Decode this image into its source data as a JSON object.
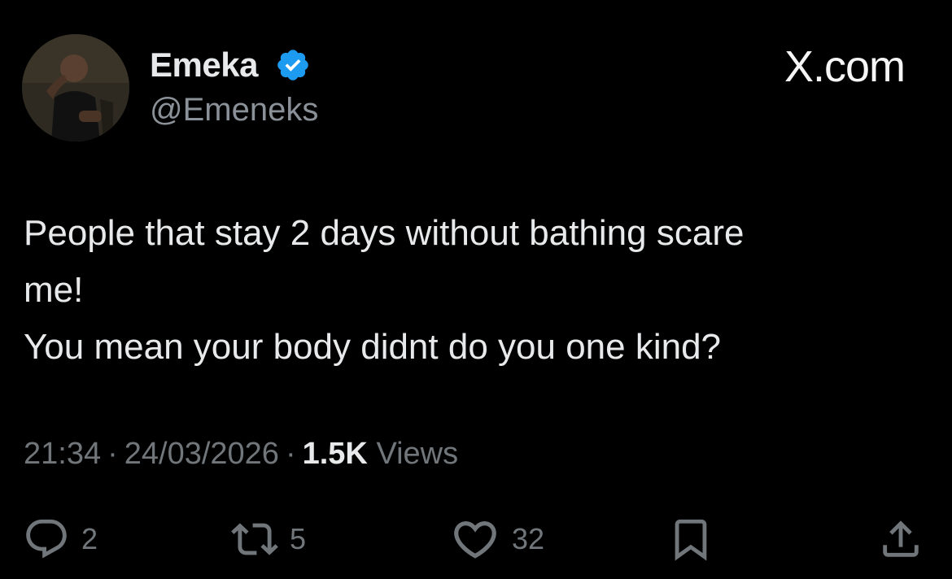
{
  "author": {
    "display_name": "Emeka",
    "handle": "@Emeneks",
    "avatar_icon": "profile-photo",
    "verified_icon": "verified-badge-icon",
    "verified_color": "#1d9bf0"
  },
  "brand": {
    "label": "X.com"
  },
  "tweet": {
    "lines": [
      "People that stay 2 days without bathing scare",
      "me!",
      "You mean your body didnt do you one kind?"
    ]
  },
  "meta": {
    "time": "21:34",
    "separator": "·",
    "date": "24/03/2026",
    "views_count": "1.5K",
    "views_label": "Views"
  },
  "actions": {
    "reply": {
      "icon": "reply-icon",
      "count": "2"
    },
    "repost": {
      "icon": "repost-icon",
      "count": "5"
    },
    "like": {
      "icon": "heart-icon",
      "count": "32"
    },
    "bookmark": {
      "icon": "bookmark-icon"
    },
    "share": {
      "icon": "share-icon"
    }
  },
  "colors": {
    "background": "#000000",
    "text_primary": "#e7e9ea",
    "text_secondary": "#71767b",
    "accent": "#1d9bf0"
  }
}
